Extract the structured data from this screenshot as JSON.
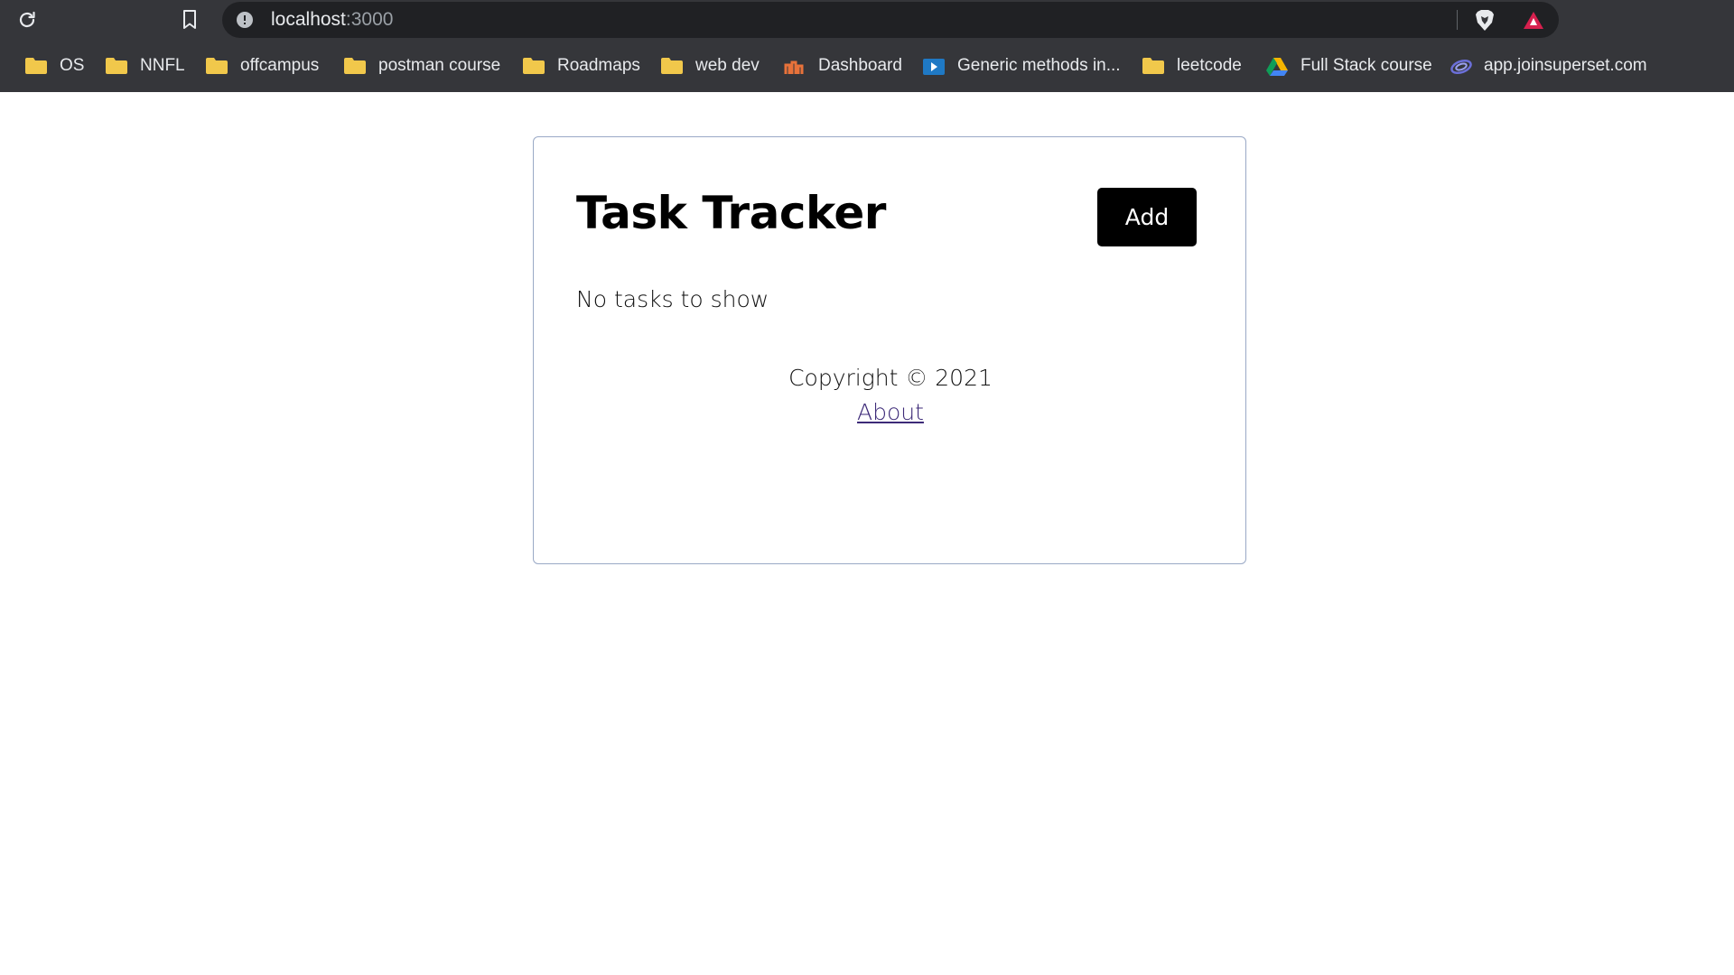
{
  "browser": {
    "url_host": "localhost",
    "url_port": ":3000",
    "bookmarks": [
      {
        "label": "OS",
        "icon": "folder-icon"
      },
      {
        "label": "NNFL",
        "icon": "folder-icon"
      },
      {
        "label": "offcampus",
        "icon": "folder-icon"
      },
      {
        "label": "postman course",
        "icon": "folder-icon"
      },
      {
        "label": "Roadmaps",
        "icon": "folder-icon"
      },
      {
        "label": "web dev",
        "icon": "folder-icon"
      },
      {
        "label": "Dashboard",
        "icon": "dashboard-site-icon"
      },
      {
        "label": "Generic methods in...",
        "icon": "video-site-icon"
      },
      {
        "label": "leetcode",
        "icon": "folder-icon"
      },
      {
        "label": "Full Stack course",
        "icon": "drive-icon"
      },
      {
        "label": "app.joinsuperset.com",
        "icon": "superset-icon"
      }
    ]
  },
  "app": {
    "title": "Task Tracker",
    "add_label": "Add",
    "empty_message": "No tasks to show",
    "footer": {
      "copyright": "Copyright © 2021",
      "about_label": "About"
    }
  },
  "colors": {
    "chrome_bg": "#35363a",
    "omnibox_bg": "#202124",
    "button_bg": "#000000",
    "link": "#3d2a78",
    "container_border": "#9aa9c6"
  }
}
